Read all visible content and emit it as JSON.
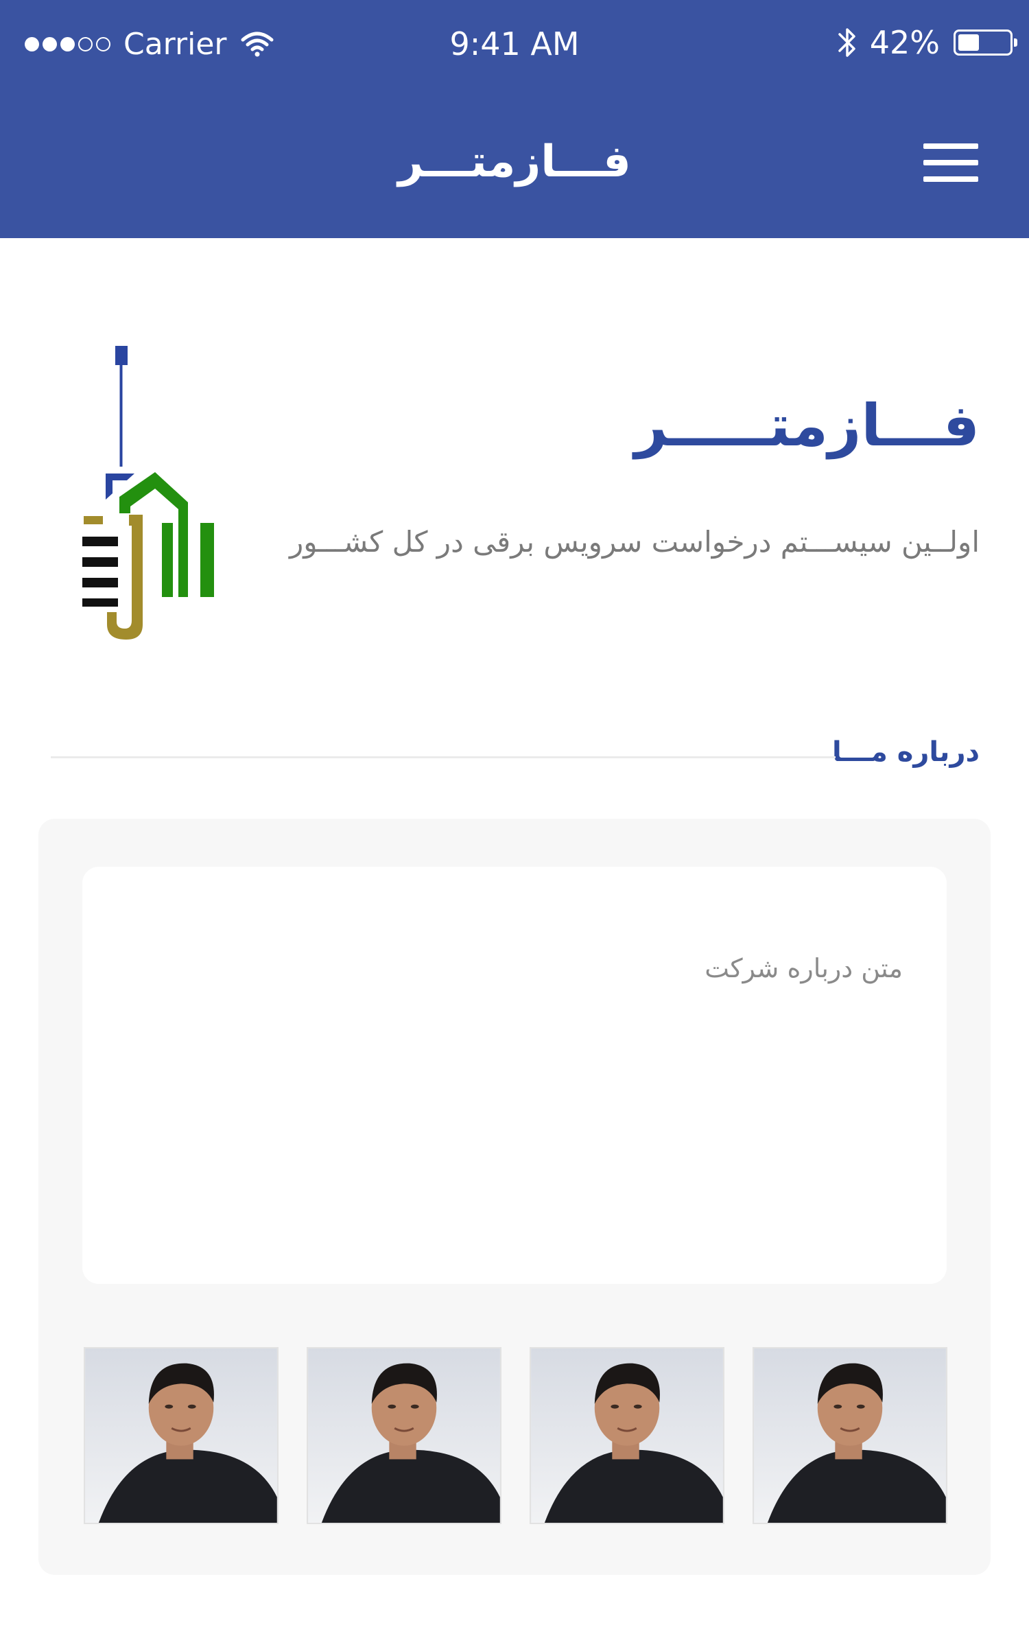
{
  "status_bar": {
    "carrier": "Carrier",
    "time": "9:41 AM",
    "battery_percent": "42%",
    "battery_level": 0.42,
    "signal_bars_filled": 3,
    "signal_bars_total": 5
  },
  "header": {
    "title": "فـــازمتـــر",
    "menu_icon": "hamburger-menu-icon",
    "background_color": "#3a53a1"
  },
  "hero": {
    "brand_title": "فـــازمتـــــر",
    "tagline": "اولــین سیســـتم درخواست سرویس برقی در کل کشـــور",
    "brand_color": "#2e4a9e",
    "logo_icon": "phazmeter-logo-icon",
    "logo_colors": [
      "#2a45a0",
      "#23900f",
      "#a28c2c",
      "#111111"
    ]
  },
  "about": {
    "section_title": "درباره مـــا",
    "text_placeholder": "متن درباره شرکت",
    "team_photos": [
      {
        "icon": "team-member-photo"
      },
      {
        "icon": "team-member-photo"
      },
      {
        "icon": "team-member-photo"
      },
      {
        "icon": "team-member-photo"
      }
    ]
  }
}
